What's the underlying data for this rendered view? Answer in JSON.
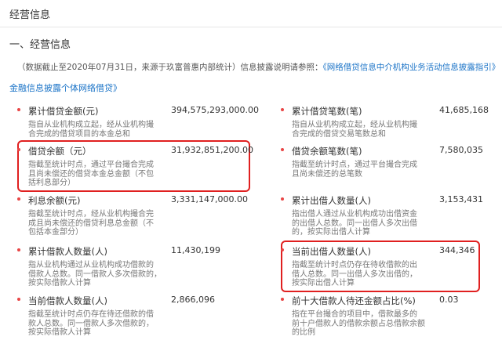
{
  "header": {
    "title": "经营信息"
  },
  "section": {
    "title": "一、经营信息"
  },
  "notice": {
    "text": "（数据截止至2020年07月31日，来源于玖富普惠内部统计）信息披露说明请参照：",
    "link1": "《网络借贷信息中介机构业务活动信息披露指引》",
    "link2": "金融信息披露个体网络借贷》"
  },
  "left_items": [
    {
      "name": "累计借贷金额(元)",
      "value": "394,575,293,000.00",
      "desc": [
        "指自从业机构成立起，经从业机构撮",
        "合完成的借贷项目的本金总和"
      ]
    },
    {
      "name": "借贷余额（元）",
      "value": "31,932,851,200.00",
      "desc": [
        "指截至统计时点，通过平台撮合完成",
        "且尚未偿还的借贷本金总金额（不包",
        "括利息部分）"
      ]
    },
    {
      "name": "利息余额(元)",
      "value": "3,331,147,000.00",
      "desc": [
        "指截至统计时点，经从业机构撮合完",
        "成且尚未偿还的借贷利息总金额（不",
        "包括本金部分）"
      ]
    },
    {
      "name": "累计借款人数量(人)",
      "value": "11,430,199",
      "desc": [
        "指从业机构通过从业机构成功借款的",
        "借款人总数。同一借款人多次借款的，",
        "按实际借款人计算"
      ]
    },
    {
      "name": "当前借款人数量(人)",
      "value": "2,866,096",
      "desc": [
        "指截至统计时点仍存在待还借款的借",
        "款人总数。同一借款人多次借款的，",
        "按实际借款人计算"
      ]
    }
  ],
  "right_items": [
    {
      "name": "累计借贷笔数(笔)",
      "value": "41,685,168",
      "desc": [
        "指自从业机构成立起，经从业机构撮",
        "合完成的借贷交易笔数总和"
      ]
    },
    {
      "name": "借贷余额笔数(笔)",
      "value": "7,580,035",
      "desc": [
        "指截至统计时点，通过平台撮合完成",
        "且尚未偿还的总笔数"
      ]
    },
    {
      "name": "累计出借人数量(人)",
      "value": "3,153,431",
      "desc": [
        "指出借人通过从业机构成功出借资金",
        "的出借人总数。同一出借人多次出借",
        "的，按实际出借人计算"
      ]
    },
    {
      "name": "当前出借人数量(人)",
      "value": "344,346",
      "desc": [
        "指截至统计时点仍存在待收借款的出",
        "借人总数。同一出借人多次出借的，",
        "按实际出借人计算"
      ]
    },
    {
      "name": "前十大借款人待还金额占比(%)",
      "value": "0.03",
      "desc": [
        "指在平台撮合的项目中，借款最多的",
        "前十户借款人的借款余额占总借款余额",
        "的比例"
      ]
    }
  ]
}
